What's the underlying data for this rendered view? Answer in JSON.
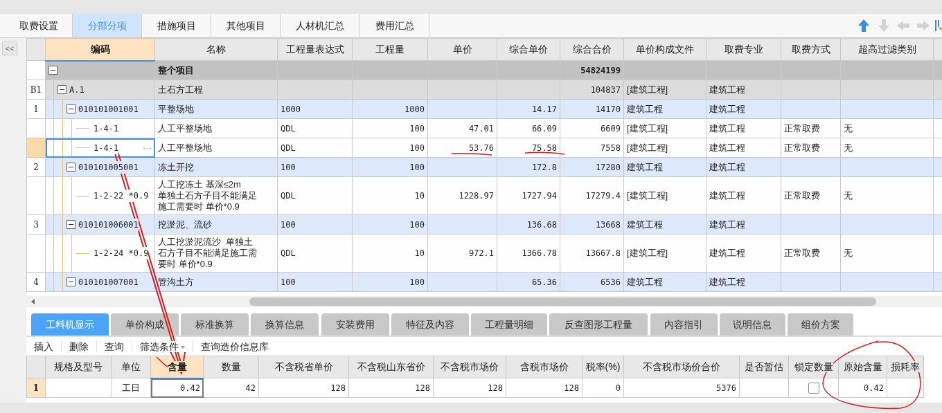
{
  "main_tabs": [
    {
      "label": "取费设置",
      "selected": false
    },
    {
      "label": "分部分项",
      "selected": true
    },
    {
      "label": "措施项目",
      "selected": false
    },
    {
      "label": "其他项目",
      "selected": false
    },
    {
      "label": "人材机汇总",
      "selected": false
    },
    {
      "label": "费用汇总",
      "selected": false
    }
  ],
  "toolbar_icons": [
    {
      "kind": "up",
      "disabled": false
    },
    {
      "kind": "down",
      "disabled": true
    },
    {
      "kind": "left",
      "disabled": true
    },
    {
      "kind": "right",
      "disabled": true
    },
    {
      "kind": "columns",
      "disabled": false
    }
  ],
  "collapse_button": "<<",
  "grid": {
    "columns": [
      {
        "label": "编码",
        "selected": true
      },
      {
        "label": "名称",
        "selected": false
      },
      {
        "label": "工程量表达式",
        "selected": false
      },
      {
        "label": "工程量",
        "selected": false
      },
      {
        "label": "单价",
        "selected": false
      },
      {
        "label": "综合单价",
        "selected": false
      },
      {
        "label": "综合合价",
        "selected": false
      },
      {
        "label": "单价构成文件",
        "selected": false
      },
      {
        "label": "取费专业",
        "selected": false
      },
      {
        "label": "取费方式",
        "selected": false
      },
      {
        "label": "超高过滤类别",
        "selected": false
      }
    ],
    "cell_button": "···",
    "rows": [
      {
        "kind": "total",
        "expanded": true,
        "selected": false,
        "cells": [
          null,
          "整个项目",
          null,
          null,
          null,
          null,
          "54824199",
          null,
          null,
          null,
          null
        ],
        "children": [
          {
            "kind": "section",
            "row_header": "B1",
            "expanded": true,
            "selected": false,
            "cells": [
              "A.1",
              "土石方工程",
              null,
              null,
              null,
              null,
              "104837",
              "[建筑工程]",
              "建筑工程",
              null,
              null
            ],
            "children": [
              {
                "kind": "item",
                "row_header": "1",
                "expanded": true,
                "selected": false,
                "cells": [
                  "010101001001",
                  "平整场地",
                  "1000",
                  "1000",
                  null,
                  "14.17",
                  "14170",
                  "建筑工程",
                  "建筑工程",
                  null,
                  null
                ],
                "children": [
                  {
                    "kind": "sub",
                    "selected": false,
                    "cells": [
                      "1-4-1",
                      "人工平整场地",
                      "QDL",
                      "100",
                      "47.01",
                      "66.09",
                      "6609",
                      "[建筑工程]",
                      "建筑工程",
                      "正常取费",
                      "无"
                    ]
                  },
                  {
                    "kind": "sub",
                    "selected": true,
                    "cells": [
                      "1-4-1",
                      "人工平整场地",
                      "QDL",
                      "100",
                      "53.76",
                      "75.58",
                      "7558",
                      "[建筑工程]",
                      "建筑工程",
                      "正常取费",
                      "无"
                    ]
                  }
                ]
              },
              {
                "kind": "item",
                "row_header": "2",
                "expanded": true,
                "selected": false,
                "cells": [
                  "010101005001",
                  "冻土开挖",
                  "100",
                  "100",
                  null,
                  "172.8",
                  "17280",
                  "建筑工程",
                  "建筑工程",
                  null,
                  null
                ],
                "children": [
                  {
                    "kind": "sub",
                    "selected": false,
                    "cells": [
                      "1-2-22 *0.9",
                      [
                        "人工挖冻土 基深≤2m",
                        "单独土石方子目不能满足",
                        "施工需要时 单价*0.9"
                      ],
                      "QDL",
                      "10",
                      "1228.97",
                      "1727.94",
                      "17279.4",
                      "[建筑工程]",
                      "建筑工程",
                      "正常取费",
                      "无"
                    ]
                  }
                ]
              },
              {
                "kind": "item",
                "row_header": "3",
                "expanded": true,
                "selected": false,
                "cells": [
                  "010101006001",
                  "挖淤泥、流砂",
                  "100",
                  "100",
                  null,
                  "136.68",
                  "13668",
                  "建筑工程",
                  "建筑工程",
                  null,
                  null
                ],
                "children": [
                  {
                    "kind": "sub",
                    "selected": false,
                    "cells": [
                      "1-2-24 *0.9",
                      [
                        "人工挖淤泥流沙  单独土",
                        "石方子目不能满足施工需",
                        "要时 单价*0.9"
                      ],
                      "QDL",
                      "10",
                      "972.1",
                      "1366.78",
                      "13667.8",
                      "[建筑工程]",
                      "建筑工程",
                      "正常取费",
                      "无"
                    ]
                  }
                ]
              },
              {
                "kind": "item",
                "row_header": "4",
                "expanded": true,
                "selected": false,
                "cells": [
                  "010101007001",
                  "管沟土方",
                  "100",
                  "100",
                  null,
                  "65.36",
                  "6536",
                  "建筑工程",
                  "建筑工程",
                  null,
                  null
                ]
              }
            ]
          }
        ]
      }
    ]
  },
  "detail_tabs": [
    {
      "label": "工料机显示",
      "selected": true
    },
    {
      "label": "单价构成",
      "selected": false
    },
    {
      "label": "标准换算",
      "selected": false
    },
    {
      "label": "换算信息",
      "selected": false
    },
    {
      "label": "安装费用",
      "selected": false
    },
    {
      "label": "特征及内容",
      "selected": false
    },
    {
      "label": "工程量明细",
      "selected": false
    },
    {
      "label": "反查图形工程量",
      "selected": false
    },
    {
      "label": "内容指引",
      "selected": false
    },
    {
      "label": "说明信息",
      "selected": false
    },
    {
      "label": "组价方案",
      "selected": false
    }
  ],
  "detail_toolbar": [
    {
      "label": "插入",
      "dropdown": false
    },
    {
      "label": "删除",
      "dropdown": false
    },
    {
      "label": "查询",
      "dropdown": false
    },
    {
      "label": "筛选条件",
      "dropdown": true
    },
    {
      "label": "查询造价信息库",
      "dropdown": false
    }
  ],
  "detail_grid": {
    "columns": [
      {
        "label": "规格及型号",
        "selected": false
      },
      {
        "label": "单位",
        "selected": false
      },
      {
        "label": "含量",
        "selected": true
      },
      {
        "label": "数量",
        "selected": false
      },
      {
        "label": "不含税省单价",
        "selected": false
      },
      {
        "label": "不含税山东省价",
        "selected": false
      },
      {
        "label": "不含税市场价",
        "selected": false
      },
      {
        "label": "含税市场价",
        "selected": false
      },
      {
        "label": "税率(%)",
        "selected": false
      },
      {
        "label": "不含税市场价合价",
        "selected": false
      },
      {
        "label": "是否暂估",
        "selected": false
      },
      {
        "label": "锁定数量",
        "selected": false
      },
      {
        "label": "原始含量",
        "selected": false
      },
      {
        "label": "损耗率",
        "selected": false
      }
    ],
    "rows": [
      {
        "row_header": "1",
        "selected": true,
        "cells": [
          null,
          "工日",
          "0.42",
          "42",
          "128",
          "128",
          "128",
          "128",
          "0",
          "5376",
          null,
          {
            "checked": false
          },
          "0.42",
          null
        ]
      }
    ]
  }
}
